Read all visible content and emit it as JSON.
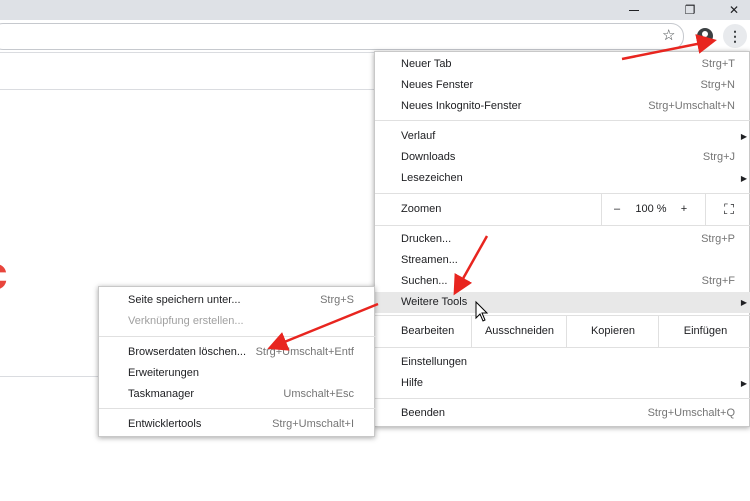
{
  "window": {
    "minimize_icon": "minimize-icon",
    "restore_icon": "restore-icon",
    "close_glyph": "✕",
    "restore_glyph": "❐"
  },
  "toolbar": {
    "star_glyph": "☆",
    "menu_glyph": "⋮"
  },
  "page": {
    "logo_fragment": "c"
  },
  "menu": {
    "group1": [
      {
        "label": "Neuer Tab",
        "shortcut": "Strg+T"
      },
      {
        "label": "Neues Fenster",
        "shortcut": "Strg+N"
      },
      {
        "label": "Neues Inkognito-Fenster",
        "shortcut": "Strg+Umschalt+N"
      }
    ],
    "group2": [
      {
        "label": "Verlauf",
        "shortcut": ""
      },
      {
        "label": "Downloads",
        "shortcut": "Strg+J"
      },
      {
        "label": "Lesezeichen",
        "shortcut": ""
      }
    ],
    "zoom": {
      "label": "Zoomen",
      "minus": "–",
      "value": "100 %",
      "plus": "+",
      "fullscreen": "⛶"
    },
    "group3": [
      {
        "label": "Drucken...",
        "shortcut": "Strg+P"
      },
      {
        "label": "Streamen...",
        "shortcut": ""
      },
      {
        "label": "Suchen...",
        "shortcut": "Strg+F"
      },
      {
        "label": "Weitere Tools",
        "shortcut": ""
      }
    ],
    "edit": {
      "label": "Bearbeiten",
      "cut": "Ausschneiden",
      "copy": "Kopieren",
      "paste": "Einfügen"
    },
    "group4": [
      {
        "label": "Einstellungen",
        "shortcut": ""
      },
      {
        "label": "Hilfe",
        "shortcut": ""
      }
    ],
    "exit": {
      "label": "Beenden",
      "shortcut": "Strg+Umschalt+Q"
    }
  },
  "submenu": {
    "items": [
      {
        "label": "Seite speichern unter...",
        "shortcut": "Strg+S"
      },
      {
        "label": "Verknüpfung erstellen...",
        "shortcut": ""
      },
      {
        "label": "Browserdaten löschen...",
        "shortcut": "Strg+Umschalt+Entf"
      },
      {
        "label": "Erweiterungen",
        "shortcut": ""
      },
      {
        "label": "Taskmanager",
        "shortcut": "Umschalt+Esc"
      },
      {
        "label": "Entwicklertools",
        "shortcut": "Strg+Umschalt+I"
      }
    ]
  },
  "colors": {
    "annotation_arrow": "#e8251f",
    "highlight": "#e8e8e8"
  }
}
